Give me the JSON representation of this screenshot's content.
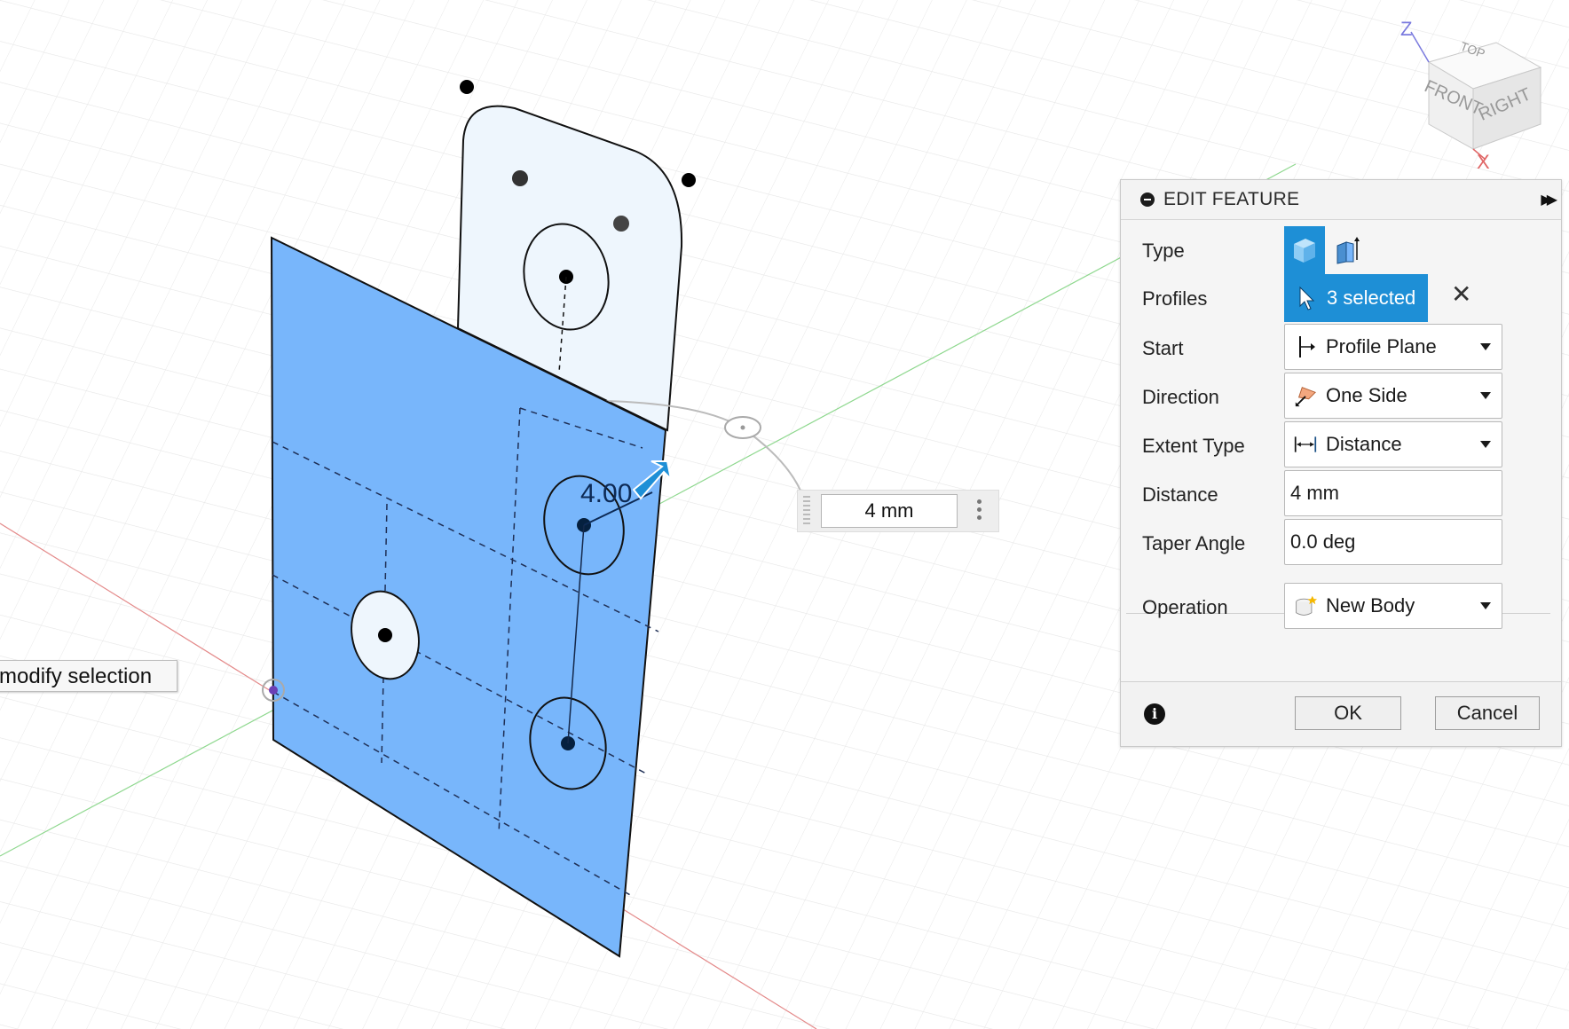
{
  "viewcube": {
    "faces": {
      "top": "TOP",
      "front": "FRONT",
      "right": "RIGHT"
    },
    "axes": {
      "z": "Z",
      "x": "X"
    }
  },
  "canvas": {
    "dimension_label": "4.00",
    "tooltip": "modify selection",
    "distance_input_value": "4 mm"
  },
  "panel": {
    "title": "EDIT FEATURE",
    "rows": {
      "type": {
        "label": "Type"
      },
      "profiles": {
        "label": "Profiles",
        "value": "3 selected"
      },
      "start": {
        "label": "Start",
        "value": "Profile Plane"
      },
      "direction": {
        "label": "Direction",
        "value": "One Side"
      },
      "extent_type": {
        "label": "Extent Type",
        "value": "Distance"
      },
      "distance": {
        "label": "Distance",
        "value": "4 mm"
      },
      "taper_angle": {
        "label": "Taper Angle",
        "value": "0.0 deg"
      },
      "operation": {
        "label": "Operation",
        "value": "New Body"
      }
    },
    "ok_label": "OK",
    "cancel_label": "Cancel"
  },
  "colors": {
    "accent": "#1e8fd6",
    "profile_fill": "#78b6fb",
    "sketch_fill": "#eef6fd",
    "axis_x": "#e06666",
    "axis_y": "#66cc66"
  }
}
